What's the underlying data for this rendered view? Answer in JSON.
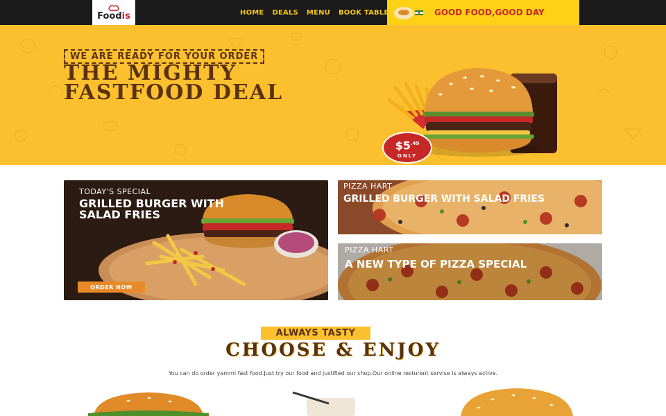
{
  "header": {
    "logo_text_a": "Food",
    "logo_text_b": "is",
    "nav": [
      "HOME",
      "DEALS",
      "MENU",
      "BOOK TABLE"
    ],
    "promo_text": "GOOD FOOD,GOOD DAY"
  },
  "hero": {
    "kicker": "WE ARE READY FOR YOUR ORDER",
    "headline": "THE MIGHTY FASTFOOD DEAL",
    "price_main": "$5",
    "price_cents": ".49",
    "price_only": "ONLY"
  },
  "cards": [
    {
      "label": "TODAY'S SPECIAL",
      "title": "GRILLED BURGER WITH SALAD FRIES",
      "button": "ORDER NOW"
    },
    {
      "label": "PIZZA HART",
      "title": "GRILLED BURGER WITH SALAD FRIES"
    },
    {
      "label": "PIZZA HART",
      "title": "A NEW TYPE OF PIZZA SPECIAL"
    }
  ],
  "section": {
    "tag": "ALWAYS TASTY",
    "title": "CHOOSE & ENJOY",
    "description": "You can do order yammi fast food.Just try our food and justified our shop.Our online resturent servise is always active."
  },
  "colors": {
    "header_bg": "#1a1a1a",
    "nav_text": "#f5c518",
    "promo_bg": "#fcd116",
    "accent_red": "#c62828",
    "hero_bg": "#fcc02e",
    "brown": "#5a3210",
    "button_orange": "#e88a2a"
  },
  "icons": [
    "chef-hat-icon",
    "food-plate-icon",
    "flag-icon"
  ]
}
